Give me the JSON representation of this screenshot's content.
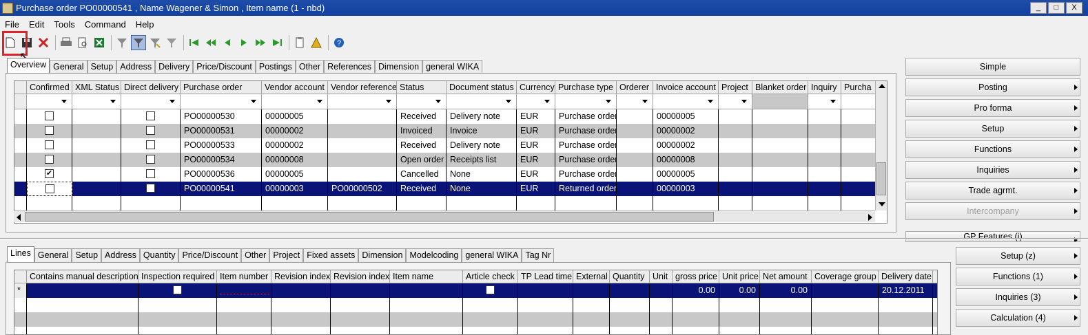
{
  "window": {
    "title": "Purchase order PO00000541 , Name Wagener & Simon , Item name (1 - nbd)",
    "min": "_",
    "max": "□",
    "close": "X"
  },
  "menu": [
    "File",
    "Edit",
    "Tools",
    "Command",
    "Help"
  ],
  "toolbar_icons": [
    "new-icon",
    "save-icon",
    "delete-icon",
    "print-icon",
    "print-preview-icon",
    "excel-icon",
    "filter-icon",
    "filter-by-selection-icon",
    "advanced-filter-icon",
    "remove-filter-icon",
    "first-record-icon",
    "previous-page-icon",
    "previous-record-icon",
    "next-record-icon",
    "next-page-icon",
    "last-record-icon",
    "document-handling-icon",
    "alert-icon",
    "help-icon"
  ],
  "top_tabs": [
    "Overview",
    "General",
    "Setup",
    "Address",
    "Delivery",
    "Price/Discount",
    "Postings",
    "Other",
    "References",
    "Dimension",
    "general WIKA"
  ],
  "top_columns": [
    "Confirmed",
    "XML Status",
    "Direct delivery",
    "Purchase order",
    "Vendor account",
    "Vendor reference",
    "Status",
    "Document status",
    "Currency",
    "Purchase type",
    "Orderer",
    "Invoice account",
    "Project",
    "Blanket order",
    "Inquiry",
    "Purcha"
  ],
  "top_rows": [
    {
      "confirmed": false,
      "direct": false,
      "po": "PO00000530",
      "vendor": "00000005",
      "vref": "",
      "status": "Received",
      "doc": "Delivery note",
      "cur": "EUR",
      "type": "Purchase order",
      "inv": "00000005"
    },
    {
      "confirmed": false,
      "direct": false,
      "po": "PO00000531",
      "vendor": "00000002",
      "vref": "",
      "status": "Invoiced",
      "doc": "Invoice",
      "cur": "EUR",
      "type": "Purchase order",
      "inv": "00000002"
    },
    {
      "confirmed": false,
      "direct": false,
      "po": "PO00000533",
      "vendor": "00000002",
      "vref": "",
      "status": "Received",
      "doc": "Delivery note",
      "cur": "EUR",
      "type": "Purchase order",
      "inv": "00000002"
    },
    {
      "confirmed": false,
      "direct": false,
      "po": "PO00000534",
      "vendor": "00000008",
      "vref": "",
      "status": "Open order",
      "doc": "Receipts list",
      "cur": "EUR",
      "type": "Purchase order",
      "inv": "00000008"
    },
    {
      "confirmed": true,
      "direct": false,
      "po": "PO00000536",
      "vendor": "00000005",
      "vref": "",
      "status": "Cancelled",
      "doc": "None",
      "cur": "EUR",
      "type": "Purchase order",
      "inv": "00000005"
    },
    {
      "confirmed": false,
      "direct": false,
      "po": "PO00000541",
      "vendor": "00000003",
      "vref": "PO00000502",
      "status": "Received",
      "doc": "None",
      "cur": "EUR",
      "type": "Returned order",
      "inv": "00000003"
    }
  ],
  "right_buttons": [
    {
      "label": "Simple",
      "arrow": false
    },
    {
      "label": "Posting",
      "arrow": true
    },
    {
      "label": "Pro forma",
      "arrow": true
    },
    {
      "label": "Setup",
      "arrow": true
    },
    {
      "label": "Functions",
      "arrow": true
    },
    {
      "label": "Inquiries",
      "arrow": true
    },
    {
      "label": "Trade agrmt.",
      "arrow": true
    },
    {
      "label": "Intercompany",
      "arrow": true,
      "disabled": true
    },
    {
      "label": "GP Features (i)",
      "arrow": true
    }
  ],
  "lower_tabs": [
    "Lines",
    "General",
    "Setup",
    "Address",
    "Quantity",
    "Price/Discount",
    "Other",
    "Project",
    "Fixed assets",
    "Dimension",
    "Modelcoding",
    "general WIKA",
    "Tag Nr"
  ],
  "lower_columns": [
    "Contains manual description",
    "Inspection required",
    "Item number",
    "Revision index",
    "Revision index",
    "Item name",
    "Article check",
    "TP Lead time",
    "External",
    "Quantity",
    "Unit",
    "gross price",
    "Unit price",
    "Net amount",
    "Coverage group",
    "Delivery date"
  ],
  "lower_row": {
    "marker": "*",
    "gross": "0.00",
    "unit_price": "0.00",
    "net": "0.00",
    "date": "20.12.2011"
  },
  "lower_buttons": [
    "Setup (z)",
    "Functions (1)",
    "Inquiries (3)",
    "Calculation (4)"
  ]
}
